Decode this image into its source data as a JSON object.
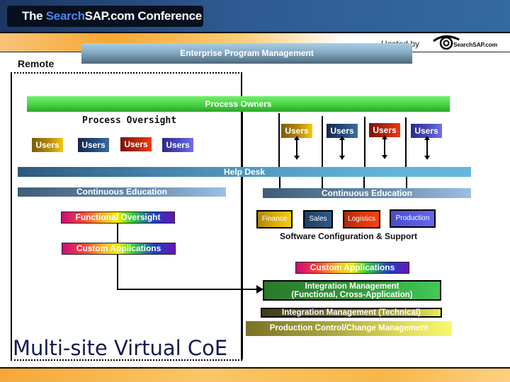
{
  "header": {
    "conference_prefix": "The ",
    "conference_highlight": "Search",
    "conference_suffix": "SAP.com Conference",
    "hosted_by": "Hosted by",
    "sponsor_logo_text": "SearchSAP.com"
  },
  "diagram": {
    "top_bar": "Enterprise Program Management",
    "remote_label": "Remote",
    "process_owners": "Process Owners",
    "process_oversight": "Process Oversight",
    "remote_users": [
      "Users",
      "Users",
      "Users",
      "Users"
    ],
    "site_users": [
      "Users",
      "Users",
      "Users",
      "Users"
    ],
    "help_desk": "Help Desk",
    "continuous_education_remote": "Continuous Education",
    "continuous_education_site": "Continuous Education",
    "functional_oversight": "Functional Oversight",
    "custom_applications_remote": "Custom Applications",
    "modules": [
      "Finance",
      "Sales",
      "Logistics",
      "Production"
    ],
    "software_config": "Software Configuration & Support",
    "custom_applications_site": "Custom Applications",
    "integration_functional_line1": "Integration Management",
    "integration_functional_line2": "(Functional, Cross-Application)",
    "integration_technical": "Integration Management (Technical)",
    "production_control": "Production Control/Change Management",
    "colors": {
      "gold": "#c89a0c",
      "navy": "#284f7c",
      "red": "#c02a0c",
      "blue": "#4a4cbc",
      "green": "#48d241",
      "help_desk": "#4d8eb6"
    }
  },
  "slide_title": "Multi-site Virtual CoE"
}
